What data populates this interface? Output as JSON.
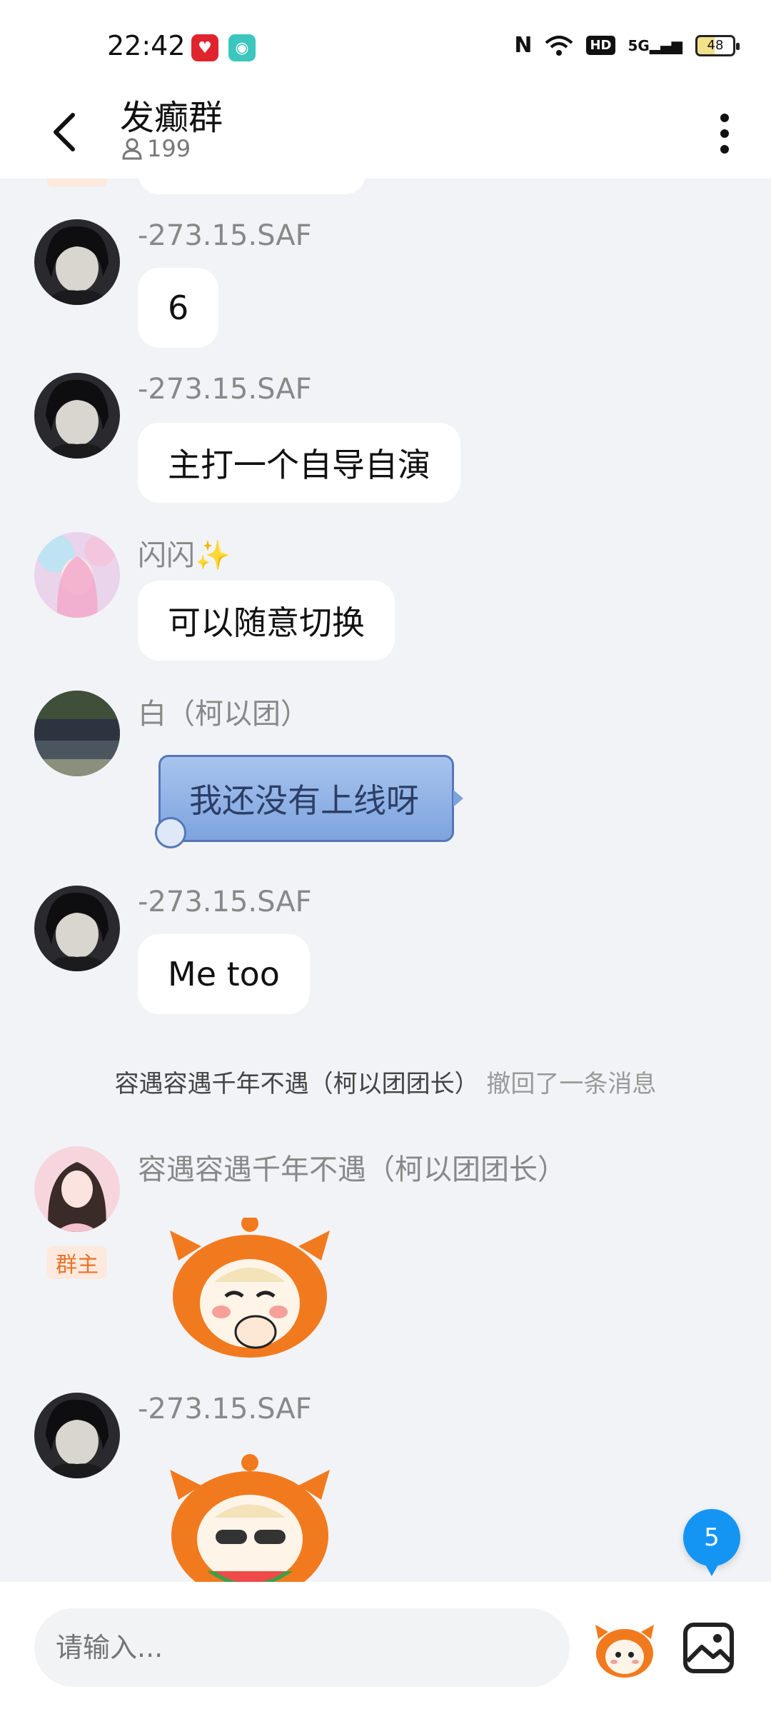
{
  "status_bar": {
    "time": "22:42",
    "battery": "48",
    "network": "5G",
    "hd": "HD"
  },
  "header": {
    "title": "发癫群",
    "member_count": "199"
  },
  "messages": [
    {
      "sender": "-273.15.SAF",
      "text": "6"
    },
    {
      "sender": "-273.15.SAF",
      "text": "主打一个自导自演"
    },
    {
      "sender": "闪闪✨",
      "text": "可以随意切换"
    },
    {
      "sender": "白（柯以团）",
      "text": "我还没有上线呀"
    },
    {
      "sender": "-273.15.SAF",
      "text": "Me too"
    },
    {
      "sender": "容遇容遇千年不遇（柯以团团长）",
      "badge": "群主",
      "sticker": "laughing-mascot-sticker"
    },
    {
      "sender": "-273.15.SAF",
      "sticker": "eating-watermelon-mascot-sticker"
    }
  ],
  "system_notice": {
    "actor": "容遇容遇千年不遇（柯以团团长）",
    "action": "撤回了一条消息"
  },
  "unread_count": "5",
  "input": {
    "placeholder": "请输入..."
  },
  "colors": {
    "accent": "#1495f3",
    "owner_badge": "#e8742a",
    "bubble": "#ffffff",
    "background": "#f2f3f7"
  }
}
